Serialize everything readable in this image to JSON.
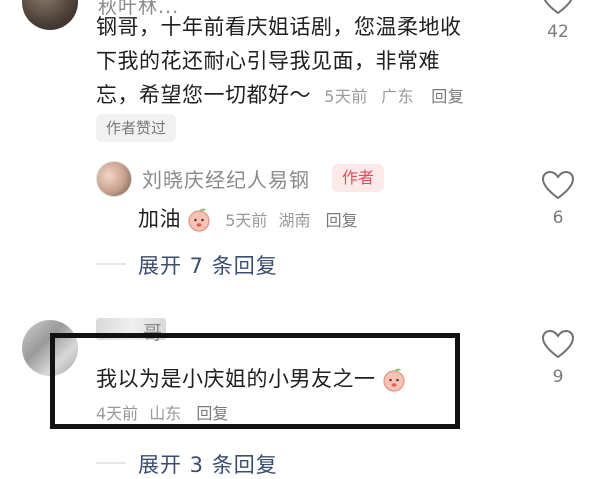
{
  "comment1": {
    "author_partial": "秋叶林...",
    "text_lines": [
      "钢哥，十年前看庆姐话剧，您温柔地收",
      "下我的花还耐心引导我见面，非常难",
      "忘，希望您一切都好～"
    ],
    "time": "5天前",
    "location": "广东",
    "reply_label": "回复",
    "liked_tag": "作者赞过",
    "like_count": "42"
  },
  "reply1": {
    "author": "刘晓庆经纪人易钢",
    "badge": "作者",
    "text": "加油",
    "emoji": "peach-face-emoji",
    "time": "5天前",
    "location": "湖南",
    "reply_label": "回复",
    "like_count": "6"
  },
  "expand1": {
    "label": "展开 7 条回复"
  },
  "comment2": {
    "author_suffix": "哥",
    "text": "我以为是小庆姐的小男友之一",
    "emoji": "peach-face-emoji",
    "time": "4天前",
    "location": "山东",
    "reply_label": "回复",
    "like_count": "9"
  },
  "expand2": {
    "label": "展开 3 条回复"
  },
  "colors": {
    "author_badge": "#e2505b",
    "expand_link": "#3b4d70",
    "muted": "#9a9a9a"
  }
}
